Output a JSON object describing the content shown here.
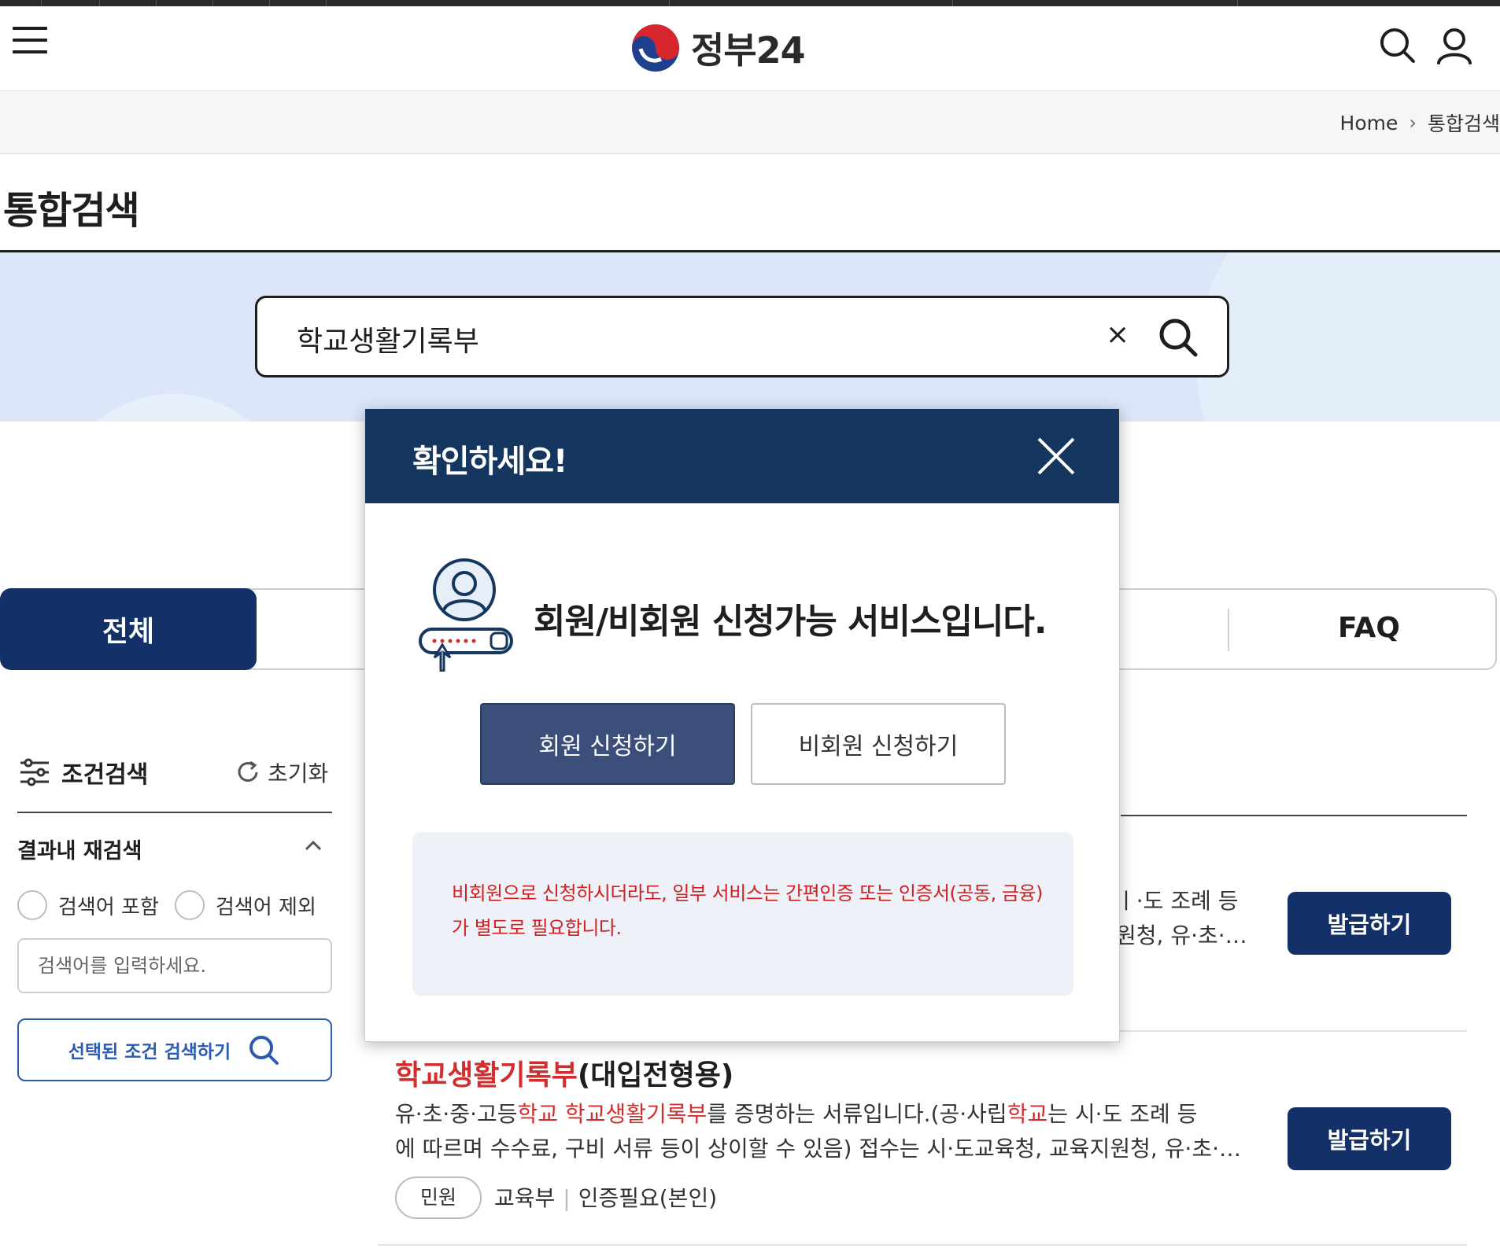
{
  "header": {
    "logo_text": "정부24",
    "menu_icon": "hamburger-menu-icon",
    "search_icon": "search-icon",
    "user_icon": "user-icon"
  },
  "breadcrumb": {
    "home": "Home",
    "current": "통합검색"
  },
  "page": {
    "title": "통합검색"
  },
  "search": {
    "query": "학교생활기록부",
    "clear_label": "×"
  },
  "tabs": {
    "all": "전체",
    "faq": "FAQ"
  },
  "filter": {
    "title": "조건검색",
    "reset": "초기화",
    "refine_title": "결과내 재검색",
    "include_label": "검색어 포함",
    "exclude_label": "검색어 제외",
    "input_placeholder": "검색어를 입력하세요.",
    "submit_label": "선택된 조건 검색하기"
  },
  "results": [
    {
      "partial_line1": "ㅣ·도 조례 등",
      "partial_line2": "원청, 유·초·…",
      "button": "발급하기"
    },
    {
      "title_highlight": "학교생활기록부",
      "title_rest": "(대입전형용)",
      "desc_line1_parts": [
        "유·초·중·고등",
        "학교 학교생활기록부",
        "를 증명하는 서류입니다.(공·사립",
        "학교",
        "는 시·도 조례 등"
      ],
      "desc_line2": "에 따르며 수수료, 구비 서류 등이 상이할 수 있음) 접수는 시·도교육청, 교육지원청, 유·초·…",
      "tag": "민원",
      "agency": "교육부",
      "auth": "인증필요(본인)",
      "button": "발급하기"
    }
  ],
  "modal": {
    "title": "확인하세요!",
    "message": "회원/비회원 신청가능 서비스입니다.",
    "member_button": "회원 신청하기",
    "guest_button": "비회원 신청하기",
    "notice_line1": "비회원으로 신청하시더라도, 일부 서비스는 간편인증 또는 인증서(공동, 금융)",
    "notice_line2": "가 별도로 필요합니다.",
    "close_icon": "close-icon",
    "illustration": "member-login-icon"
  },
  "colors": {
    "navy": "#143068",
    "modal_header": "#15365f",
    "highlight_red": "#d12f2f",
    "band_blue": "#dbe7f9"
  }
}
